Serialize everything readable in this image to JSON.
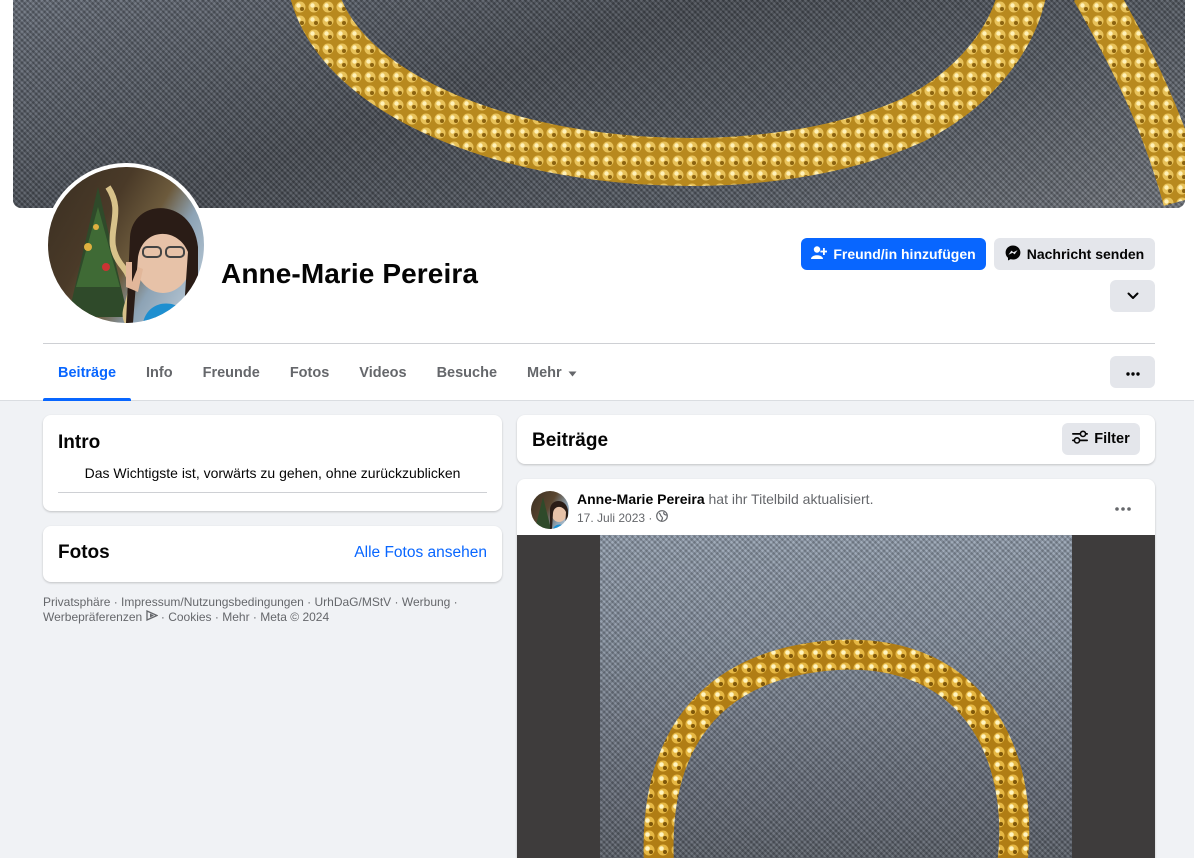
{
  "profile": {
    "name": "Anne-Marie Pereira",
    "add_friend_label": "Freund/in hinzufügen",
    "message_label": "Nachricht senden"
  },
  "tabs": [
    {
      "label": "Beiträge",
      "active": true
    },
    {
      "label": "Info"
    },
    {
      "label": "Freunde"
    },
    {
      "label": "Fotos"
    },
    {
      "label": "Videos"
    },
    {
      "label": "Besuche"
    },
    {
      "label": "Mehr"
    }
  ],
  "intro": {
    "title": "Intro",
    "bio": "Das Wichtigste ist, vorwärts zu gehen, ohne zurückzublicken"
  },
  "fotos": {
    "title": "Fotos",
    "link": "Alle Fotos ansehen"
  },
  "footer": {
    "links": [
      "Privatsphäre",
      "Impressum/Nutzungsbedingungen",
      "UrhDaG/MStV",
      "Werbung",
      "Werbepräferenzen",
      "Cookies",
      "Mehr"
    ],
    "copyright": "Meta © 2024"
  },
  "posts": {
    "title": "Beiträge",
    "filter_label": "Filter",
    "items": [
      {
        "author": "Anne-Marie Pereira",
        "action": "hat ihr Titelbild aktualisiert.",
        "date": "17. Juli 2023 ·",
        "privacy_icon": "globe-icon"
      }
    ]
  },
  "colors": {
    "accent": "#0866ff",
    "background": "#f0f2f5",
    "secondary_button": "#e4e6eb",
    "muted_text": "#65676b"
  }
}
